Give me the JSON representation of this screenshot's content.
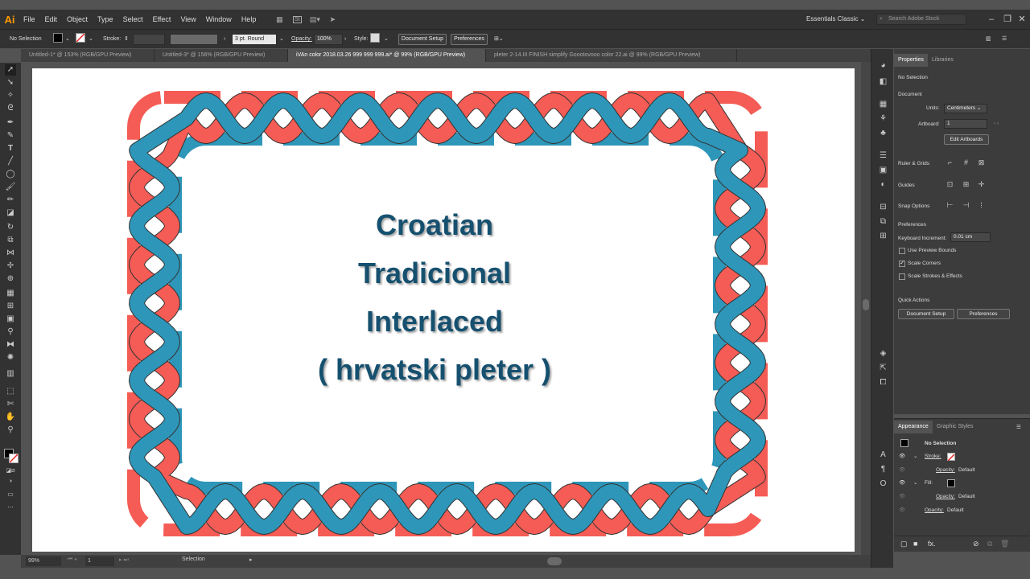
{
  "app": {
    "logo": "Ai"
  },
  "menu": [
    "File",
    "Edit",
    "Object",
    "Type",
    "Select",
    "Effect",
    "View",
    "Window",
    "Help"
  ],
  "menubar_icons": [
    "bridge-icon",
    "stock-icon",
    "arrange-docs-icon",
    "gpu-rocket-icon"
  ],
  "menubar_stock_label": "St",
  "workspace": "Essentials Classic",
  "search": {
    "placeholder": "Search Adobe Stock"
  },
  "control_bar": {
    "selection_label": "No Selection",
    "stroke_label": "Stroke:",
    "brush": "3 pt. Round",
    "opacity_label": "Opacity:",
    "opacity_value": "100%",
    "style_label": "Style:",
    "document_setup": "Document Setup",
    "preferences": "Preferences"
  },
  "tabs": [
    {
      "label": "Untitled-1* @ 153% (RGB/GPU Preview)",
      "active": false
    },
    {
      "label": "Untitled-3* @ 156% (RGB/GPU Preview)",
      "active": false
    },
    {
      "label": "iVAn color 2018.03.26 999 999 999.ai* @ 99% (RGB/GPU Preview)",
      "active": true
    },
    {
      "label": "pleter 2-14.III FINISH  simplify Goootovooo color 22.ai @ 99% (RGB/GPU Preview)",
      "active": false
    }
  ],
  "artwork": {
    "lines": [
      "Croatian",
      "Tradicional",
      "Interlaced",
      "( hrvatski  pleter )"
    ],
    "colors": {
      "red": "#f45c55",
      "blue": "#2e96b9",
      "text": "#16506f"
    }
  },
  "status": {
    "zoom": "99%",
    "page": "1",
    "tool": "Selection"
  },
  "properties": {
    "tab_active": "Properties",
    "tab_other": "Libraries",
    "selection": "No Selection",
    "document_heading": "Document",
    "units_label": "Units:",
    "units_value": "Centimeters",
    "artboard_label": "Artboard:",
    "artboard_value": "1",
    "edit_artboards": "Edit Artboards",
    "ruler_grids": "Ruler & Grids",
    "guides": "Guides",
    "snap_options": "Snap Options",
    "preferences_heading": "Preferences",
    "keyboard_increment_label": "Keyboard Increment:",
    "keyboard_increment_value": "0.01 cm",
    "use_preview_bounds": "Use Preview Bounds",
    "scale_corners": "Scale Corners",
    "scale_strokes": "Scale Strokes & Effects",
    "checks": {
      "use_preview_bounds": false,
      "scale_corners": true,
      "scale_strokes": false
    },
    "quick_actions": "Quick Actions",
    "document_setup": "Document Setup",
    "preferences": "Preferences"
  },
  "appearance": {
    "tab_active": "Appearance",
    "tab_other": "Graphic Styles",
    "selection": "No Selection",
    "stroke_label": "Stroke:",
    "opacity_label": "Opacity:",
    "opacity_value": "Default",
    "fill_label": "Fill:",
    "fx_label": "fx."
  }
}
